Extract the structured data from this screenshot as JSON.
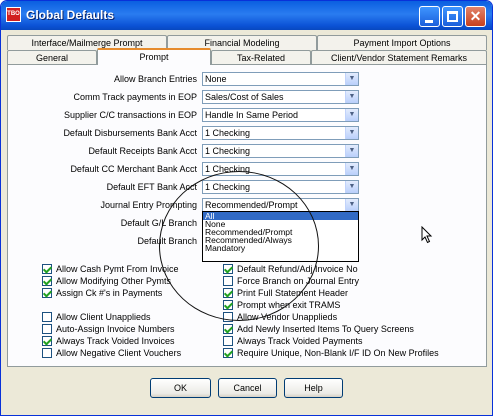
{
  "window": {
    "title": "Global Defaults",
    "app_icon_text": "TBO"
  },
  "tabs": {
    "row1": [
      "Interface/Mailmerge Prompt",
      "Financial Modeling",
      "Payment Import Options"
    ],
    "row2": [
      "General",
      "Prompt",
      "Tax-Related",
      "Client/Vendor Statement Remarks"
    ],
    "selected": "Prompt"
  },
  "fields": [
    {
      "label": "Allow Branch Entries",
      "value": "None"
    },
    {
      "label": "Comm Track payments in EOP",
      "value": "Sales/Cost of Sales"
    },
    {
      "label": "Supplier C/C transactions in EOP",
      "value": "Handle In Same Period"
    },
    {
      "label": "Default Disbursements Bank Acct",
      "value": "1 Checking"
    },
    {
      "label": "Default Receipts Bank Acct",
      "value": "1 Checking"
    },
    {
      "label": "Default CC Merchant Bank Acct",
      "value": "1 Checking"
    },
    {
      "label": "Default EFT Bank Acct",
      "value": "1 Checking"
    },
    {
      "label": "Journal Entry Prompting",
      "value": "Recommended/Prompt"
    },
    {
      "label": "Default G/L Branch",
      "value": ""
    },
    {
      "label": "Default Branch",
      "value": ""
    }
  ],
  "dropdown": {
    "options": [
      "All",
      "None",
      "Recommended/Prompt",
      "Recommended/Always",
      "Mandatory"
    ],
    "highlighted": "All"
  },
  "checkboxes": {
    "left": [
      {
        "label": "Allow Cash Pymt From Invoice",
        "checked": true
      },
      {
        "label": "Allow Modifying Other Pymts",
        "checked": true
      },
      {
        "label": "Assign Ck #'s in Payments",
        "checked": true
      },
      {
        "label": "Allow Client Unapplieds",
        "checked": false
      },
      {
        "label": "Auto-Assign Invoice Numbers",
        "checked": false
      },
      {
        "label": "Always Track Voided Invoices",
        "checked": true
      },
      {
        "label": "Allow Negative Client Vouchers",
        "checked": false
      }
    ],
    "right": [
      {
        "label": "Default Refund/Adj Invoice No",
        "checked": true
      },
      {
        "label": "Force Branch on Journal Entry",
        "checked": false
      },
      {
        "label": "Print Full Statement Header",
        "checked": true
      },
      {
        "label": "Prompt when exit TRAMS",
        "checked": true
      },
      {
        "label": "Allow Vendor Unapplieds",
        "checked": false
      },
      {
        "label": "Add Newly Inserted Items To Query Screens",
        "checked": true
      },
      {
        "label": "Always Track Voided Payments",
        "checked": false
      },
      {
        "label": "Require Unique, Non-Blank I/F ID On New Profiles",
        "checked": true
      }
    ]
  },
  "buttons": {
    "ok": "OK",
    "cancel": "Cancel",
    "help": "Help"
  },
  "colors": {
    "titlebar": "#0a5fe0",
    "selection": "#316ac5",
    "dialog_bg": "#ece9d8"
  }
}
